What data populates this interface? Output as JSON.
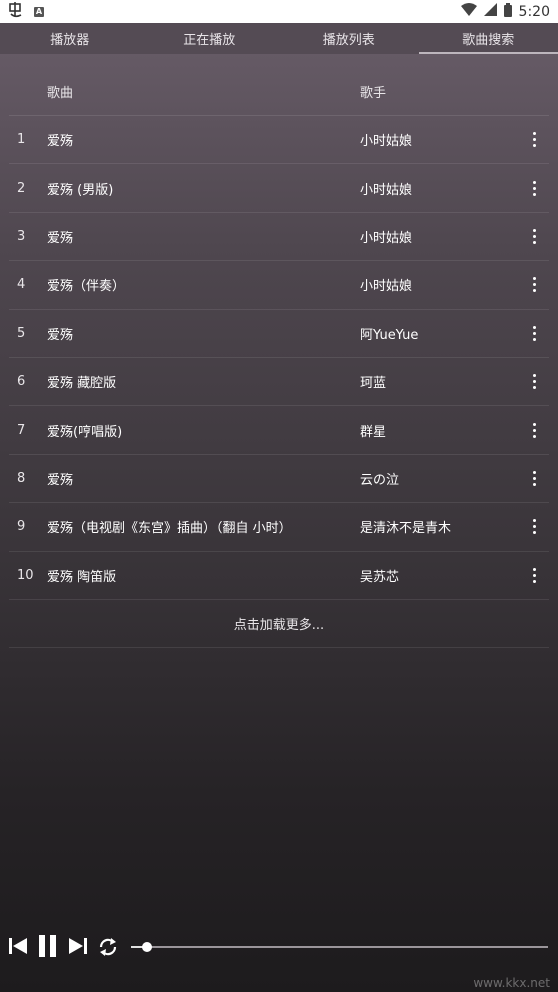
{
  "status_bar": {
    "time": "5:20",
    "left_icons": [
      "app-icon",
      "a-badge-icon"
    ],
    "right_icons": [
      "wifi-icon",
      "signal-icon",
      "battery-icon"
    ],
    "a_badge_letter": "A"
  },
  "tabs": [
    {
      "label": "播放器",
      "active": false
    },
    {
      "label": "正在播放",
      "active": false
    },
    {
      "label": "播放列表",
      "active": false
    },
    {
      "label": "歌曲搜索",
      "active": true
    }
  ],
  "table": {
    "headers": {
      "song": "歌曲",
      "artist": "歌手"
    },
    "rows": [
      {
        "index": "1",
        "song": "爱殇",
        "artist": "小时姑娘"
      },
      {
        "index": "2",
        "song": "爱殇 (男版)",
        "artist": "小时姑娘"
      },
      {
        "index": "3",
        "song": "爱殇",
        "artist": "小时姑娘"
      },
      {
        "index": "4",
        "song": "爱殇（伴奏）",
        "artist": "小时姑娘"
      },
      {
        "index": "5",
        "song": "爱殇",
        "artist": "阿YueYue"
      },
      {
        "index": "6",
        "song": "爱殇 藏腔版",
        "artist": "珂蓝"
      },
      {
        "index": "7",
        "song": "爱殇(哼唱版)",
        "artist": "群星"
      },
      {
        "index": "8",
        "song": "爱殇",
        "artist": "云の泣"
      },
      {
        "index": "9",
        "song": "爱殇（电视剧《东宫》插曲）（翻自 小时）",
        "artist": "是清沐不是青木"
      },
      {
        "index": "10",
        "song": "爱殇 陶笛版",
        "artist": "吴苏芯"
      }
    ],
    "load_more": "点击加载更多..."
  },
  "player": {
    "controls": [
      "skip-previous-icon",
      "pause-icon",
      "skip-next-icon",
      "repeat-icon"
    ],
    "progress": 0.04
  },
  "watermark": "www.kkx.net",
  "colors": {
    "tab_bar": "#544b54",
    "active_indicator": "#bdb6bd",
    "status_bar": "#ffffff"
  }
}
